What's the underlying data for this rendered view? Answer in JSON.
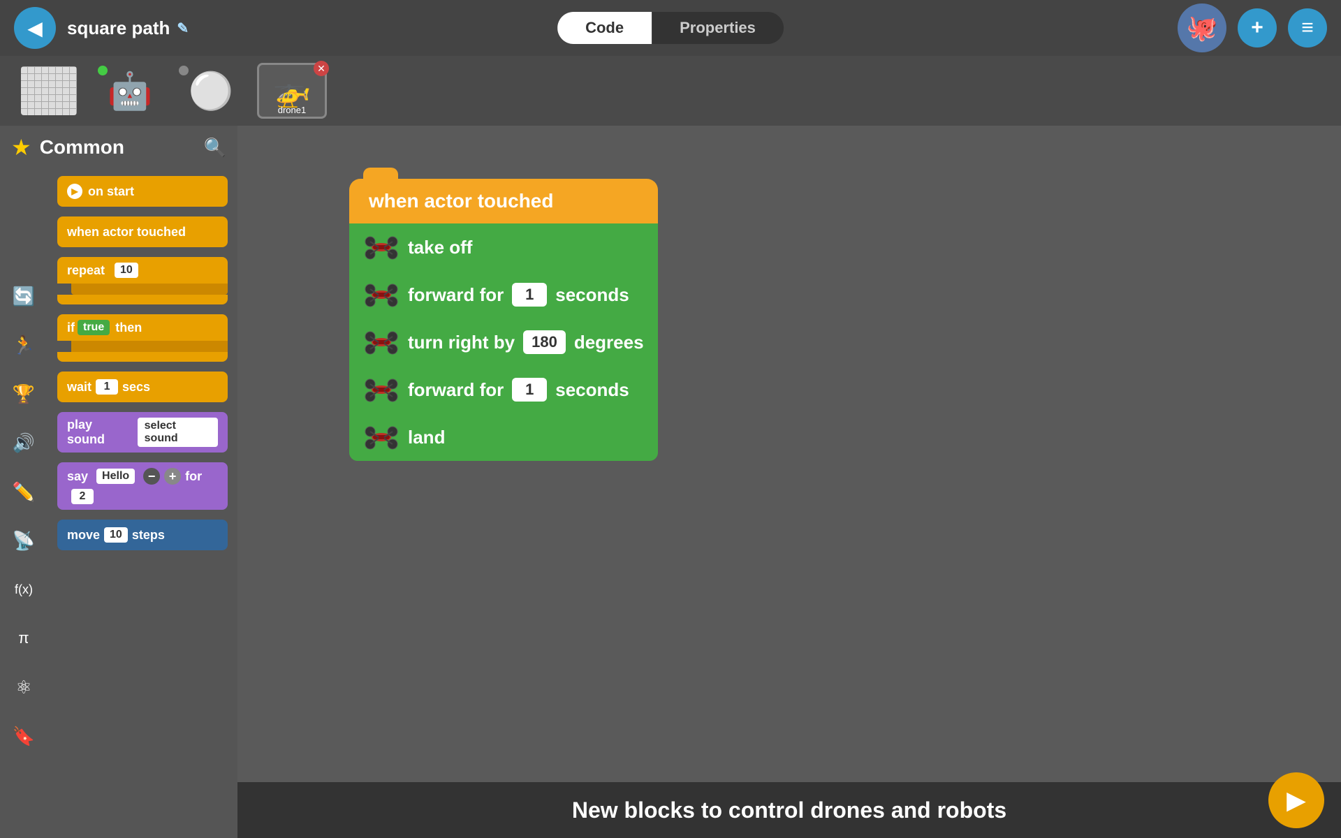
{
  "header": {
    "back_label": "◀",
    "project_title": "square path",
    "edit_icon": "✎",
    "tab_code": "Code",
    "tab_properties": "Properties",
    "plus_btn": "+",
    "menu_btn": "≡"
  },
  "devices": [
    {
      "id": "grid",
      "label": "",
      "indicator": "none",
      "icon": "grid"
    },
    {
      "id": "omo",
      "label": "",
      "indicator": "green",
      "icon": "robot"
    },
    {
      "id": "sphero",
      "label": "",
      "indicator": "gray",
      "icon": "ball"
    },
    {
      "id": "drone1",
      "label": "drone1",
      "indicator": "none",
      "icon": "drone",
      "selected": true,
      "has_close": true
    }
  ],
  "sidebar": {
    "category_label": "Common",
    "icons": [
      {
        "name": "loops-icon",
        "symbol": "🔄"
      },
      {
        "name": "motion-icon",
        "symbol": "🏃"
      },
      {
        "name": "events-icon",
        "symbol": "🏆"
      },
      {
        "name": "sound-icon",
        "symbol": "🔊"
      },
      {
        "name": "pen-icon",
        "symbol": "✏️"
      },
      {
        "name": "sensors-icon",
        "symbol": "📡"
      },
      {
        "name": "functions-icon",
        "symbol": "f(x)"
      },
      {
        "name": "math-icon",
        "symbol": "π"
      },
      {
        "name": "variables-icon",
        "symbol": "⚛"
      },
      {
        "name": "bookmark-icon",
        "symbol": "🔖"
      }
    ],
    "blocks": [
      {
        "type": "event",
        "label": "on start",
        "color": "orange"
      },
      {
        "type": "event",
        "label": "when actor touched",
        "color": "orange"
      },
      {
        "type": "repeat",
        "label": "repeat",
        "value": "10",
        "color": "orange"
      },
      {
        "type": "if",
        "label": "if",
        "true_val": "true",
        "then_label": "then",
        "color": "orange"
      },
      {
        "type": "wait",
        "label": "wait",
        "value": "1",
        "unit": "secs",
        "color": "orange"
      },
      {
        "type": "sound",
        "label": "play sound",
        "select_label": "select sound",
        "color": "purple"
      },
      {
        "type": "say",
        "label": "say",
        "say_val": "Hello",
        "for_label": "for",
        "for_val": "2",
        "color": "purple"
      },
      {
        "type": "move",
        "label": "move",
        "value": "10",
        "unit": "steps",
        "color": "dark-blue"
      }
    ]
  },
  "code_canvas": {
    "hat_block": "when actor touched",
    "action_blocks": [
      {
        "label": "take off",
        "has_drone": true
      },
      {
        "label": "forward for",
        "has_input": true,
        "input_val": "1",
        "suffix": "seconds",
        "has_drone": true
      },
      {
        "label": "turn right by",
        "has_input": true,
        "input_val": "180",
        "suffix": "degrees",
        "has_drone": true
      },
      {
        "label": "forward for",
        "has_input": true,
        "input_val": "1",
        "suffix": "seconds",
        "has_drone": true
      },
      {
        "label": "land",
        "has_drone": true
      }
    ]
  },
  "bottom": {
    "message": "New blocks to control drones and robots",
    "play_btn": "▶"
  }
}
